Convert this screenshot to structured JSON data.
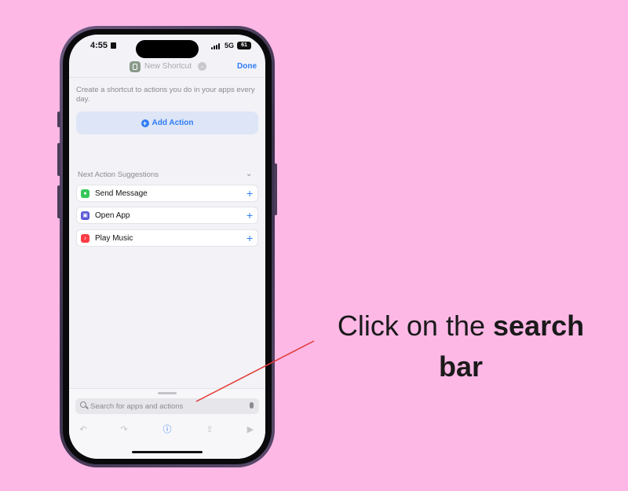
{
  "status_bar": {
    "time": "4:55",
    "network": "5G",
    "battery": "61"
  },
  "nav": {
    "title": "New Shortcut",
    "done_label": "Done"
  },
  "editor": {
    "intro_text": "Create a shortcut to actions you do in your apps every day.",
    "add_action_label": "Add Action"
  },
  "suggestions": {
    "heading": "Next Action Suggestions",
    "items": [
      {
        "label": "Send Message",
        "icon": "messages-icon",
        "color": "#34c759"
      },
      {
        "label": "Open App",
        "icon": "open-app-icon",
        "color": "#5856d6"
      },
      {
        "label": "Play Music",
        "icon": "music-icon",
        "color": "#fc3c44"
      }
    ]
  },
  "search": {
    "placeholder": "Search for apps and actions"
  },
  "toolbar": {
    "icons": [
      "undo-icon",
      "redo-icon",
      "info-icon",
      "share-icon",
      "play-icon"
    ]
  },
  "callout": {
    "text_regular": "Click on the ",
    "text_bold": "search bar"
  },
  "colors": {
    "background": "#fdb8e6",
    "accent": "#2f7cf6",
    "arrow": "#e53935"
  }
}
